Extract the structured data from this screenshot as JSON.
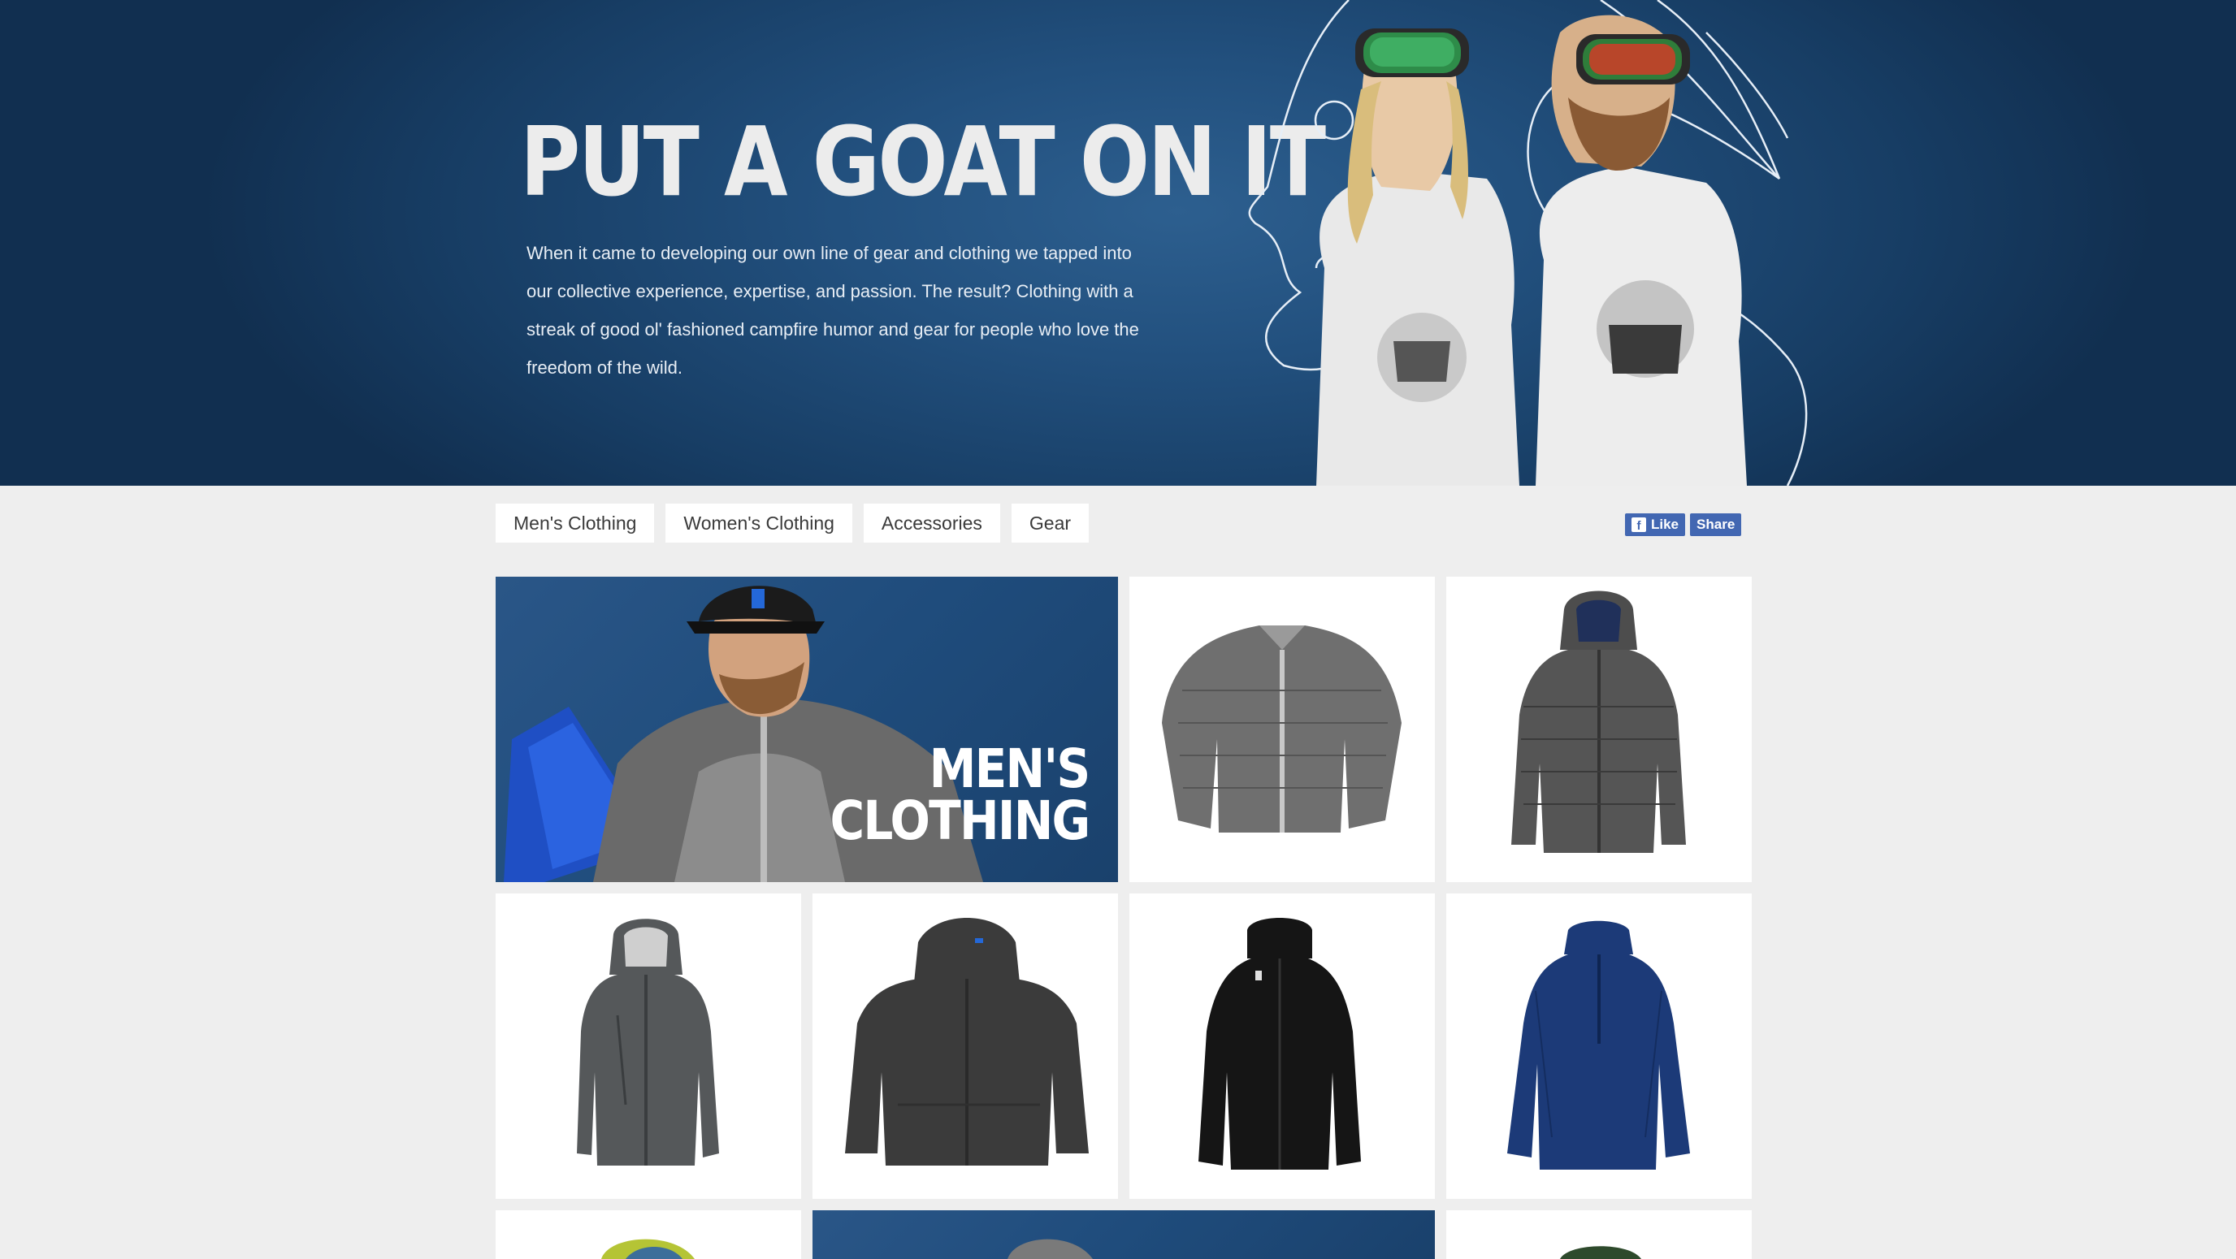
{
  "hero": {
    "title": "PUT A GOAT ON IT",
    "description": "When it came to developing our own line of gear and clothing we tapped into our collective experience, expertise, and passion. The result? Clothing with a streak of good ol' fashioned campfire humor and gear for people who love the freedom of the wild."
  },
  "tabs": [
    {
      "label": "Men's Clothing"
    },
    {
      "label": "Women's Clothing"
    },
    {
      "label": "Accessories"
    },
    {
      "label": "Gear"
    }
  ],
  "social": {
    "like_label": "Like",
    "share_label": "Share",
    "like_icon": "facebook-f-icon"
  },
  "feature": {
    "title_line1": "MEN'S",
    "title_line2": "CLOTHING"
  },
  "products": [
    {
      "name": "silver-down-jacket",
      "color": "#6f6f6f"
    },
    {
      "name": "gray-down-hoodie",
      "color": "#4d4d4d"
    },
    {
      "name": "gray-shell-jacket",
      "color": "#55585a"
    },
    {
      "name": "charcoal-fleece-hoodie",
      "color": "#3b3b3b"
    },
    {
      "name": "black-fleece-jacket",
      "color": "#151515"
    },
    {
      "name": "navy-quarter-zip",
      "color": "#1c3a78"
    }
  ],
  "colors": {
    "hero_bg": "#1d4672",
    "page_bg": "#eeeeee",
    "facebook": "#4267b2",
    "feature_bg": "#22507e"
  }
}
